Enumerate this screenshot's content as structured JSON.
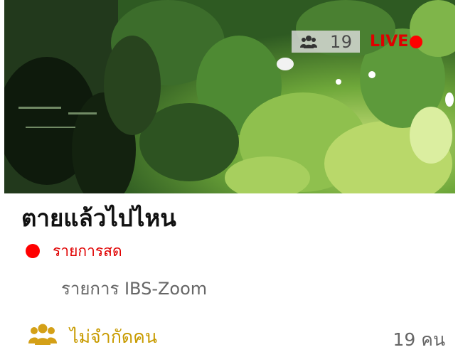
{
  "thumbnail": {
    "viewer_count": "19",
    "live_label": "LIVE",
    "colors": {
      "live": "#e00000",
      "badge_bg": "#dcdcdc"
    }
  },
  "title": "ตายแล้วไปไหน",
  "status": {
    "label": "รายการสด",
    "color": "#e00000"
  },
  "program": "รายการ IBS-Zoom",
  "capacity": {
    "icon": "people-icon",
    "label": "ไม่จำกัดคน",
    "color": "#c89b00"
  },
  "viewers_text": "19 คน"
}
